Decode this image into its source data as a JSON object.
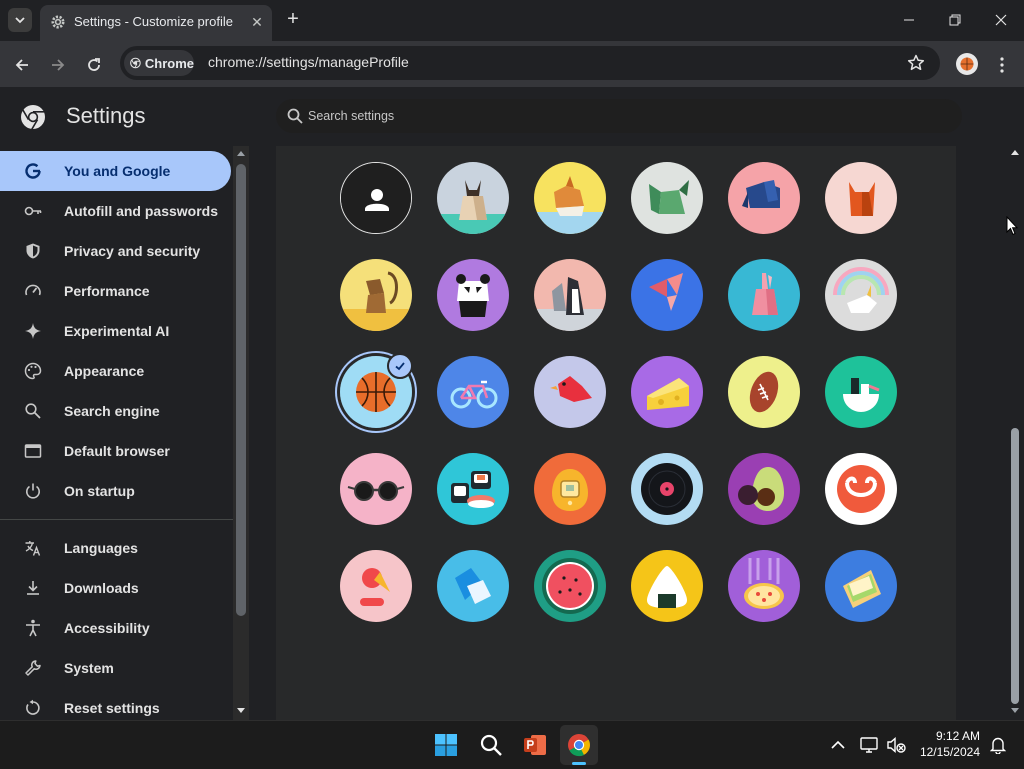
{
  "browser": {
    "tab_title": "Settings - Customize profile",
    "omnibox_chip": "Chrome",
    "url": "chrome://settings/manageProfile"
  },
  "settings": {
    "title": "Settings",
    "search_placeholder": "Search settings"
  },
  "sidebar": {
    "items": [
      {
        "label": "You and Google",
        "icon": "google-g-icon",
        "active": true
      },
      {
        "label": "Autofill and passwords",
        "icon": "key-icon"
      },
      {
        "label": "Privacy and security",
        "icon": "shield-icon"
      },
      {
        "label": "Performance",
        "icon": "speedometer-icon"
      },
      {
        "label": "Experimental AI",
        "icon": "sparkle-icon"
      },
      {
        "label": "Appearance",
        "icon": "palette-icon"
      },
      {
        "label": "Search engine",
        "icon": "magnifier-icon"
      },
      {
        "label": "Default browser",
        "icon": "browser-window-icon"
      },
      {
        "label": "On startup",
        "icon": "power-icon"
      },
      {
        "label": "Languages",
        "icon": "translate-icon"
      },
      {
        "label": "Downloads",
        "icon": "download-icon"
      },
      {
        "label": "Accessibility",
        "icon": "accessibility-icon"
      },
      {
        "label": "System",
        "icon": "wrench-icon"
      },
      {
        "label": "Reset settings",
        "icon": "reset-icon"
      }
    ]
  },
  "avatars": {
    "selected": "basketball",
    "items": [
      {
        "name": "generic-person",
        "bg": "#1f1f1f"
      },
      {
        "name": "origami-cat",
        "bg": "#c9d3de"
      },
      {
        "name": "origami-corgi",
        "bg": "#f7e25f"
      },
      {
        "name": "origami-dragon",
        "bg": "#dfe3e0"
      },
      {
        "name": "origami-elephant",
        "bg": "#f5a3a8"
      },
      {
        "name": "origami-fox",
        "bg": "#f6d7d2"
      },
      {
        "name": "origami-monkey",
        "bg": "#f5e07a"
      },
      {
        "name": "origami-panda",
        "bg": "#b07ae0"
      },
      {
        "name": "origami-penguin",
        "bg": "#f2b8ae"
      },
      {
        "name": "origami-butterfly",
        "bg": "#3b73e6"
      },
      {
        "name": "origami-rabbit",
        "bg": "#38b8d4"
      },
      {
        "name": "origami-unicorn",
        "bg": "#dcdcdc"
      },
      {
        "name": "basketball",
        "bg": "#9fdcf5"
      },
      {
        "name": "bike",
        "bg": "#4e86e8"
      },
      {
        "name": "red-bird",
        "bg": "#c4c8ea"
      },
      {
        "name": "cheese",
        "bg": "#a86ae6"
      },
      {
        "name": "football",
        "bg": "#eef08c"
      },
      {
        "name": "sushi-bowl",
        "bg": "#1ec29a"
      },
      {
        "name": "sunglasses",
        "bg": "#f5b3c8"
      },
      {
        "name": "sushi-roll",
        "bg": "#2fc6d8"
      },
      {
        "name": "digital-pet",
        "bg": "#f06b3a"
      },
      {
        "name": "vinyl-record",
        "bg": "#b3dcf3"
      },
      {
        "name": "avocado",
        "bg": "#9a3fb3"
      },
      {
        "name": "smile",
        "bg": "#ffffff"
      },
      {
        "name": "ice-cream",
        "bg": "#f6c5c9"
      },
      {
        "name": "origami-shape",
        "bg": "#48bde8"
      },
      {
        "name": "watermelon",
        "bg": "#1f9e85"
      },
      {
        "name": "onigiri",
        "bg": "#f5c518"
      },
      {
        "name": "pizza",
        "bg": "#a15fd9"
      },
      {
        "name": "sandwich",
        "bg": "#3d7de0"
      }
    ]
  },
  "taskbar": {
    "time": "9:12 AM",
    "date": "12/15/2024",
    "apps": [
      "windows-start-icon",
      "search-icon",
      "powerpoint-icon",
      "chrome-icon"
    ]
  },
  "colors": {
    "accent": "#a8c7fa",
    "active_text": "#062e6f"
  }
}
